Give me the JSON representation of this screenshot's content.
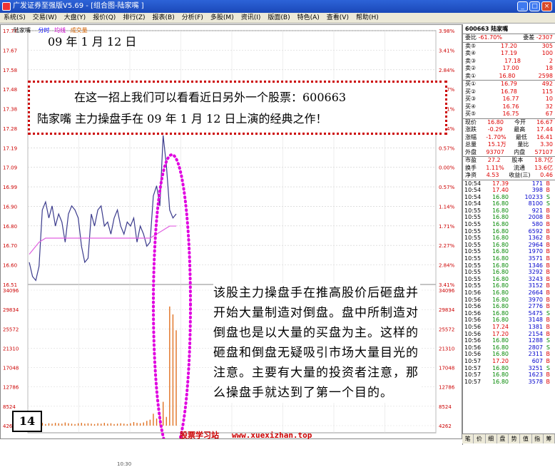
{
  "window": {
    "title": "广发证券至强版V5.69 - [组合图-陆家嘴 ]"
  },
  "menu": [
    "系统(S)",
    "交易(W)",
    "大盘(Y)",
    "报价(Q)",
    "排行(Z)",
    "报表(B)",
    "分析(F)",
    "多股(M)",
    "资讯(I)",
    "版面(B)",
    "特色(A)",
    "查看(V)",
    "帮助(H)"
  ],
  "chart_header": {
    "stock": "陆家嘴",
    "leg1": "分时",
    "leg2": "均线",
    "leg3": "成交量"
  },
  "left_axis": [
    "17.77",
    "17.67",
    "17.58",
    "17.48",
    "17.38",
    "17.28",
    "17.19",
    "17.09",
    "16.99",
    "16.90",
    "16.80",
    "16.70",
    "16.60",
    "16.51"
  ],
  "right_axis": [
    "3.98%",
    "3.41%",
    "2.84%",
    "2.27%",
    "1.71%",
    "1.14%",
    "0.57%",
    "0.00%",
    "0.57%",
    "1.14%",
    "1.71%",
    "2.27%",
    "2.84%",
    "3.41%"
  ],
  "vol_axis_left": [
    "34096",
    "29834",
    "25572",
    "21310",
    "17048",
    "12786",
    "8524",
    "4262"
  ],
  "vol_axis_right": [
    "34096",
    "29834",
    "25572",
    "21310",
    "17048",
    "12786",
    "8524",
    "4262"
  ],
  "time_label": "10:30",
  "date_caption": "09 年 1 月 12 日",
  "note": {
    "line1": "在这一招上我们可以看看近日另外一个股票：600663",
    "line2": "陆家嘴 主力操盘手在 09 年 1 月 12 日上演的经典之作！"
  },
  "explain": "该股主力操盘手在推高股价后砸盘并开始大量制造对倒盘。盘中所制造对倒盘也是以大量的买盘为主。这样的砸盘和倒盘无疑吸引市场大量目光的注意。主要有大量的投资者注意，那么操盘手就达到了第一个目的。",
  "page_number": "14",
  "watermark": {
    "site": "股票学习站",
    "url": "www.xuexizhan.top"
  },
  "panel": {
    "header": "600663 陆家嘴",
    "weibi": {
      "label1": "委比",
      "v1": "-61.70%",
      "label2": "委差",
      "v2": "-2307"
    },
    "asks": [
      {
        "l": "卖⑤",
        "p": "17.20",
        "v": "305"
      },
      {
        "l": "卖④",
        "p": "17.19",
        "v": "100"
      },
      {
        "l": "卖③",
        "p": "17.18",
        "v": "2"
      },
      {
        "l": "卖②",
        "p": "17.00",
        "v": "18"
      },
      {
        "l": "卖①",
        "p": "16.80",
        "v": "2598"
      }
    ],
    "bids": [
      {
        "l": "买①",
        "p": "16.79",
        "v": "492"
      },
      {
        "l": "买②",
        "p": "16.78",
        "v": "115"
      },
      {
        "l": "买③",
        "p": "16.77",
        "v": "10"
      },
      {
        "l": "买④",
        "p": "16.76",
        "v": "32"
      },
      {
        "l": "买⑤",
        "p": "16.75",
        "v": "67"
      }
    ],
    "stats": [
      {
        "a": "现价",
        "b": "16.80",
        "c": "今开",
        "d": "16.67"
      },
      {
        "a": "涨跌",
        "b": "-0.29",
        "c": "最高",
        "d": "17.44"
      },
      {
        "a": "涨幅",
        "b": "-1.70%",
        "c": "最低",
        "d": "16.41"
      },
      {
        "a": "总量",
        "b": "15.1万",
        "c": "量比",
        "d": "3.30"
      },
      {
        "a": "外盘",
        "b": "93707",
        "c": "内盘",
        "d": "57107"
      }
    ],
    "stats2": [
      {
        "a": "市盈",
        "b": "27.2",
        "c": "股本",
        "d": "18.7亿"
      },
      {
        "a": "换手",
        "b": "1.11%",
        "c": "流通",
        "d": "13.6亿"
      },
      {
        "a": "净资",
        "b": "4.53",
        "c": "收益(三)",
        "d": "0.46"
      }
    ],
    "ticks": [
      {
        "t": "10:54",
        "p": "17.39",
        "v": "171",
        "s": "B"
      },
      {
        "t": "10:54",
        "p": "17.40",
        "v": "398",
        "s": "B"
      },
      {
        "t": "10:54",
        "p": "16.80",
        "v": "10233",
        "s": "S"
      },
      {
        "t": "10:54",
        "p": "16.80",
        "v": "8100",
        "s": "S"
      },
      {
        "t": "10:55",
        "p": "16.80",
        "v": "921",
        "s": "B"
      },
      {
        "t": "10:55",
        "p": "16.80",
        "v": "2008",
        "s": "B"
      },
      {
        "t": "10:55",
        "p": "16.80",
        "v": "580",
        "s": "B"
      },
      {
        "t": "10:55",
        "p": "16.80",
        "v": "6592",
        "s": "B"
      },
      {
        "t": "10:55",
        "p": "16.80",
        "v": "1362",
        "s": "B"
      },
      {
        "t": "10:55",
        "p": "16.80",
        "v": "2964",
        "s": "B"
      },
      {
        "t": "10:55",
        "p": "16.80",
        "v": "1970",
        "s": "B"
      },
      {
        "t": "10:55",
        "p": "16.80",
        "v": "3571",
        "s": "B"
      },
      {
        "t": "10:55",
        "p": "16.80",
        "v": "1346",
        "s": "B"
      },
      {
        "t": "10:55",
        "p": "16.80",
        "v": "3292",
        "s": "B"
      },
      {
        "t": "10:55",
        "p": "16.80",
        "v": "3243",
        "s": "B"
      },
      {
        "t": "10:55",
        "p": "16.80",
        "v": "3152",
        "s": "B"
      },
      {
        "t": "10:56",
        "p": "16.80",
        "v": "2664",
        "s": "B"
      },
      {
        "t": "10:56",
        "p": "16.80",
        "v": "3970",
        "s": "B"
      },
      {
        "t": "10:56",
        "p": "16.80",
        "v": "2776",
        "s": "B"
      },
      {
        "t": "10:56",
        "p": "16.80",
        "v": "5475",
        "s": "S"
      },
      {
        "t": "10:56",
        "p": "16.80",
        "v": "3148",
        "s": "B"
      },
      {
        "t": "10:56",
        "p": "17.24",
        "v": "1381",
        "s": "B"
      },
      {
        "t": "10:56",
        "p": "17.20",
        "v": "2154",
        "s": "B"
      },
      {
        "t": "10:56",
        "p": "16.80",
        "v": "1288",
        "s": "S"
      },
      {
        "t": "10:56",
        "p": "16.80",
        "v": "2807",
        "s": "S"
      },
      {
        "t": "10:56",
        "p": "16.80",
        "v": "2311",
        "s": "B"
      },
      {
        "t": "10:57",
        "p": "17.20",
        "v": "607",
        "s": "B"
      },
      {
        "t": "10:57",
        "p": "16.80",
        "v": "3251",
        "s": "S"
      },
      {
        "t": "10:57",
        "p": "16.80",
        "v": "1623",
        "s": "B"
      },
      {
        "t": "10:57",
        "p": "16.80",
        "v": "3578",
        "s": "B"
      }
    ],
    "tabs": [
      "笔",
      "价",
      "细",
      "盘",
      "势",
      "值",
      "指",
      "筹"
    ]
  },
  "chart_data": {
    "type": "line",
    "title": "",
    "xlabel": "",
    "ylabel": "",
    "ylim": [
      16.51,
      17.77
    ],
    "series": [
      {
        "name": "分时",
        "values": [
          16.62,
          16.55,
          16.53,
          16.6,
          16.88,
          16.92,
          16.84,
          16.9,
          16.8,
          16.86,
          16.82,
          16.72,
          16.86,
          16.9,
          16.88,
          16.84,
          16.7,
          16.62,
          16.64,
          16.86,
          16.8,
          16.88,
          16.9,
          16.8,
          16.82,
          16.76,
          16.84,
          16.88,
          16.8,
          16.76,
          16.82,
          16.8,
          16.84,
          16.72,
          16.8,
          16.76,
          16.7,
          16.72,
          16.95,
          17.0,
          16.9,
          17.25,
          17.1,
          16.88,
          16.84,
          16.86
        ]
      },
      {
        "name": "均线",
        "values": [
          16.66,
          16.68,
          16.7,
          16.72,
          16.73,
          16.74,
          16.74,
          16.74,
          16.74,
          16.74,
          16.74,
          16.74,
          16.74,
          16.74,
          16.74,
          16.74,
          16.74,
          16.74,
          16.74,
          16.74,
          16.74,
          16.74,
          16.74,
          16.74,
          16.74,
          16.74,
          16.74,
          16.74,
          16.74,
          16.74,
          16.74,
          16.74,
          16.74,
          16.74,
          16.74,
          16.74,
          16.74,
          16.74,
          16.75,
          16.76,
          16.77,
          16.78,
          16.79,
          16.8,
          16.8,
          16.8
        ]
      }
    ],
    "volume": [
      800,
      600,
      900,
      500,
      700,
      400,
      600,
      500,
      700,
      600,
      500,
      800,
      600,
      500,
      400,
      600,
      700,
      500,
      600,
      500,
      400,
      600,
      500,
      700,
      500,
      600,
      400,
      500,
      600,
      500,
      400,
      600,
      900,
      700,
      600,
      800,
      1200,
      1500,
      3000,
      1800,
      2600,
      6000,
      2200,
      30000,
      28000,
      24000
    ]
  },
  "colors": {
    "price": "#3a3a8c",
    "avg": "#e060e0",
    "vol": "#e07020",
    "highlight": "#e000e0",
    "accent": "#c00000"
  }
}
